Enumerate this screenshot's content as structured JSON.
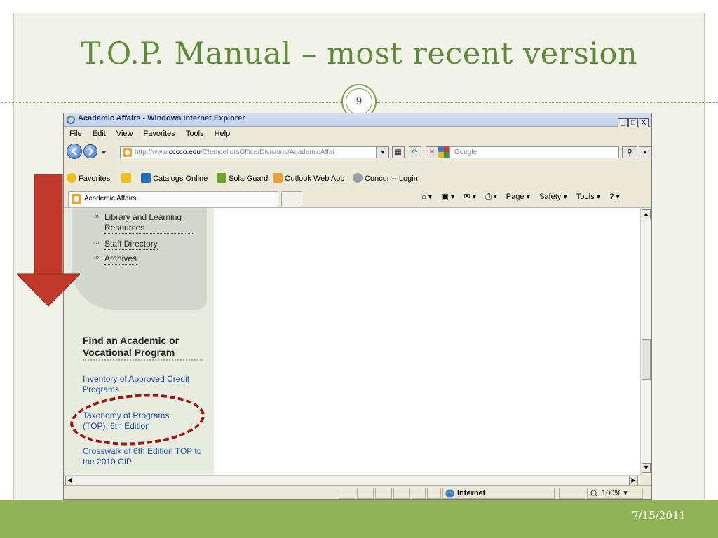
{
  "slide": {
    "title": "T.O.P. Manual – most recent version",
    "page_number": "9",
    "date": "7/15/2011",
    "accent_color": "#5e8a3a",
    "footer_color": "#8fb356"
  },
  "browser": {
    "window_title": "Academic Affairs - Windows Internet Explorer",
    "window_buttons": [
      "_",
      "□",
      "X"
    ],
    "menu": [
      "File",
      "Edit",
      "View",
      "Favorites",
      "Tools",
      "Help"
    ],
    "address_prefix": "http://www.",
    "address_domain": "cccco.edu",
    "address_path": "/ChancellorsOffice/Divisions/AcademicAffai",
    "search_placeholder": "Google",
    "favorites": {
      "label": "Favorites",
      "items": [
        "Catalogs Online",
        "SolarGuard",
        "Outlook Web App",
        "Concur -- Login"
      ]
    },
    "tab_label": "Academic Affairs",
    "command_items": [
      "Page ▾",
      "Safety ▾",
      "Tools ▾"
    ],
    "status_zone": "Internet",
    "zoom": "100%"
  },
  "page": {
    "nav_links": [
      "Library and Learning Resources",
      "Staff Directory",
      "Archives"
    ],
    "section_heading": "Find an Academic or Vocational Program",
    "program_links": [
      "Inventory of Approved Credit Programs",
      "Taxonomy of Programs (TOP), 6th Edition",
      "Crosswalk of 6th Edition TOP to the 2010 CIP"
    ]
  },
  "annotations": {
    "arrow_color": "#c0392b",
    "highlight_color": "#a31515"
  }
}
